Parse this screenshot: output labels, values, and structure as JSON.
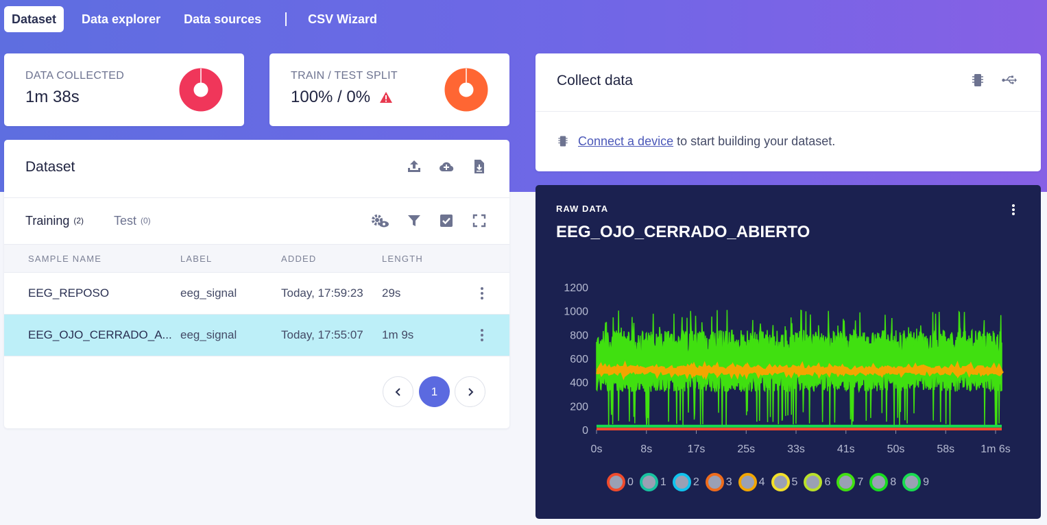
{
  "nav": {
    "items": [
      {
        "label": "Dataset",
        "active": true
      },
      {
        "label": "Data explorer",
        "active": false
      },
      {
        "label": "Data sources",
        "active": false
      }
    ],
    "after_sep": {
      "label": "CSV Wizard"
    }
  },
  "stats": {
    "data_collected": {
      "label": "DATA COLLECTED",
      "value": "1m 38s",
      "color": "#f0365a"
    },
    "split": {
      "label": "TRAIN / TEST SPLIT",
      "value": "100% / 0%",
      "color": "#ff6633"
    }
  },
  "dataset": {
    "title": "Dataset",
    "tabs": [
      {
        "label": "Training",
        "count": "(2)"
      },
      {
        "label": "Test",
        "count": "(0)"
      }
    ],
    "columns": [
      "SAMPLE NAME",
      "LABEL",
      "ADDED",
      "LENGTH"
    ],
    "rows": [
      {
        "name": "EEG_REPOSO",
        "label": "eeg_signal",
        "added": "Today, 17:59:23",
        "length": "29s"
      },
      {
        "name": "EEG_OJO_CERRADO_A...",
        "label": "eeg_signal",
        "added": "Today, 17:55:07",
        "length": "1m 9s"
      }
    ],
    "page": "1"
  },
  "collect": {
    "title": "Collect data",
    "link": "Connect a device",
    "text": " to start building your dataset."
  },
  "raw": {
    "label": "RAW DATA",
    "title": "EEG_OJO_CERRADO_ABIERTO"
  },
  "chart_data": {
    "type": "line",
    "title": "EEG_OJO_CERRADO_ABIERTO",
    "x_ticks": [
      "0s",
      "8s",
      "17s",
      "25s",
      "33s",
      "41s",
      "50s",
      "58s",
      "1m 6s"
    ],
    "y_ticks": [
      "1200",
      "1000",
      "800",
      "600",
      "400",
      "200",
      "0"
    ],
    "ylim": [
      0,
      1200
    ],
    "x_duration_s": 69,
    "legend_placement": "bottom",
    "series": [
      {
        "name": "0",
        "color": "#f04b2c",
        "approx_level": 0
      },
      {
        "name": "1",
        "color": "#18c2a0",
        "approx_level": 0
      },
      {
        "name": "2",
        "color": "#10c4ee",
        "approx_level": 0
      },
      {
        "name": "3",
        "color": "#ef6c1c",
        "approx_level": 0
      },
      {
        "name": "4",
        "color": "#f2a600",
        "approx_level": 500,
        "approx_band": [
          470,
          540
        ]
      },
      {
        "name": "5",
        "color": "#f2e02a",
        "approx_level": 0
      },
      {
        "name": "6",
        "color": "#b9e02a",
        "approx_level": 0
      },
      {
        "name": "7",
        "color": "#40e010",
        "approx_range": [
          0,
          1000
        ],
        "approx_mean": 600
      },
      {
        "name": "8",
        "color": "#18dc20",
        "approx_level": 0
      },
      {
        "name": "9",
        "color": "#18dc50",
        "approx_level": 30
      }
    ]
  }
}
